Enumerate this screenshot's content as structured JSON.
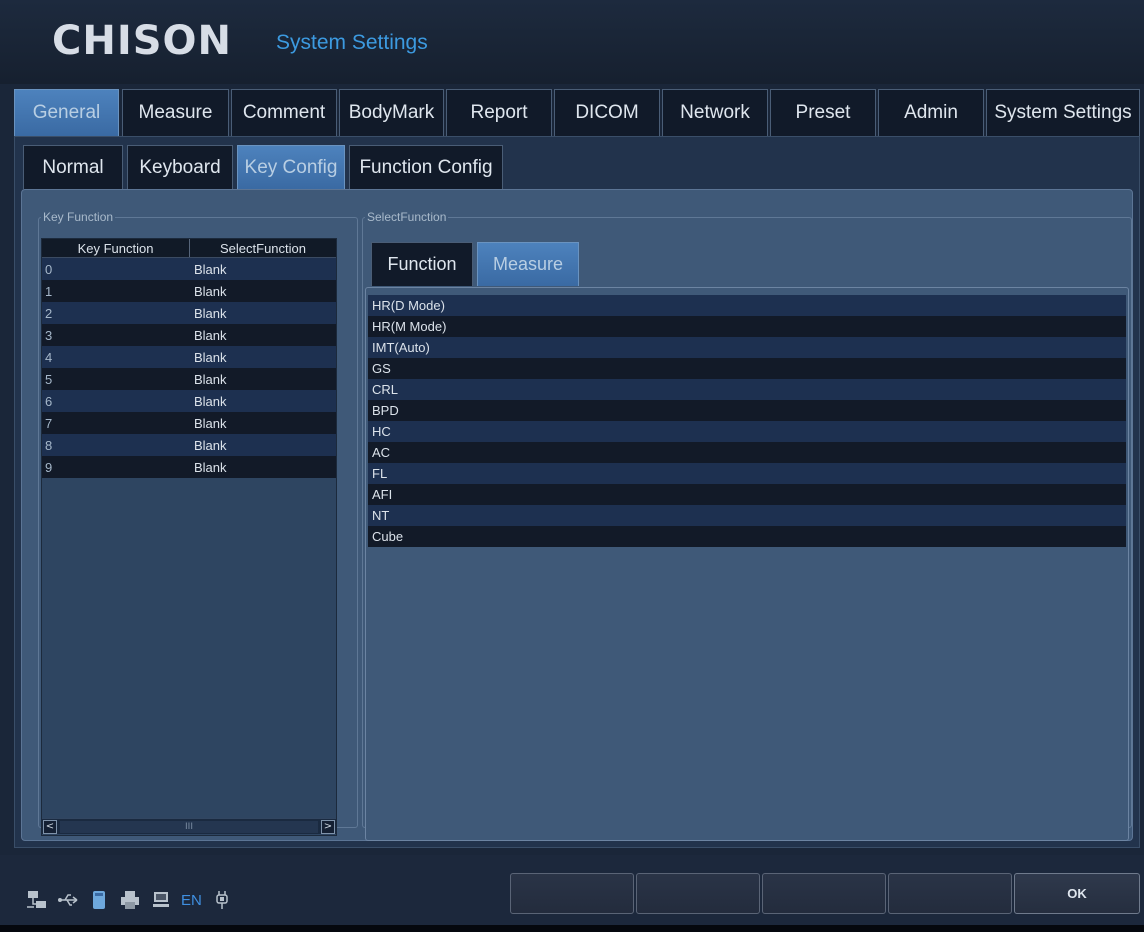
{
  "header": {
    "logo": "CHISON",
    "title": "System Settings"
  },
  "main_tabs": [
    {
      "label": "General",
      "active": true
    },
    {
      "label": "Measure"
    },
    {
      "label": "Comment"
    },
    {
      "label": "BodyMark"
    },
    {
      "label": "Report"
    },
    {
      "label": "DICOM"
    },
    {
      "label": "Network"
    },
    {
      "label": "Preset"
    },
    {
      "label": "Admin"
    },
    {
      "label": "System Settings"
    }
  ],
  "sub_tabs": [
    {
      "label": "Normal"
    },
    {
      "label": "Keyboard"
    },
    {
      "label": "Key Config",
      "active": true
    },
    {
      "label": "Function Config"
    }
  ],
  "key_function": {
    "legend": "Key Function",
    "columns": [
      "Key Function",
      "SelectFunction"
    ],
    "rows": [
      {
        "key": "0",
        "function": "Blank"
      },
      {
        "key": "1",
        "function": "Blank"
      },
      {
        "key": "2",
        "function": "Blank"
      },
      {
        "key": "3",
        "function": "Blank"
      },
      {
        "key": "4",
        "function": "Blank"
      },
      {
        "key": "5",
        "function": "Blank"
      },
      {
        "key": "6",
        "function": "Blank"
      },
      {
        "key": "7",
        "function": "Blank"
      },
      {
        "key": "8",
        "function": "Blank"
      },
      {
        "key": "9",
        "function": "Blank"
      }
    ],
    "scrollbar": {
      "left": "<",
      "thumb": "III",
      "right": ">"
    }
  },
  "select_function": {
    "legend": "SelectFunction",
    "tabs": [
      {
        "label": "Function"
      },
      {
        "label": "Measure",
        "active": true
      }
    ],
    "items": [
      "HR(D Mode)",
      "HR(M Mode)",
      "IMT(Auto)",
      "GS",
      "CRL",
      "BPD",
      "HC",
      "AC",
      "FL",
      "AFI",
      "NT",
      "Cube"
    ]
  },
  "status_bar": {
    "icons": [
      "network-icon",
      "usb-icon",
      "disk-icon",
      "printer-icon",
      "monitor-icon",
      "power-plug-icon"
    ],
    "language": "EN"
  },
  "buttons": {
    "ok": "OK"
  },
  "colors": {
    "accent": "#3c9ae0",
    "active_tab": "#4d82bd",
    "panel": "#3f5978"
  }
}
